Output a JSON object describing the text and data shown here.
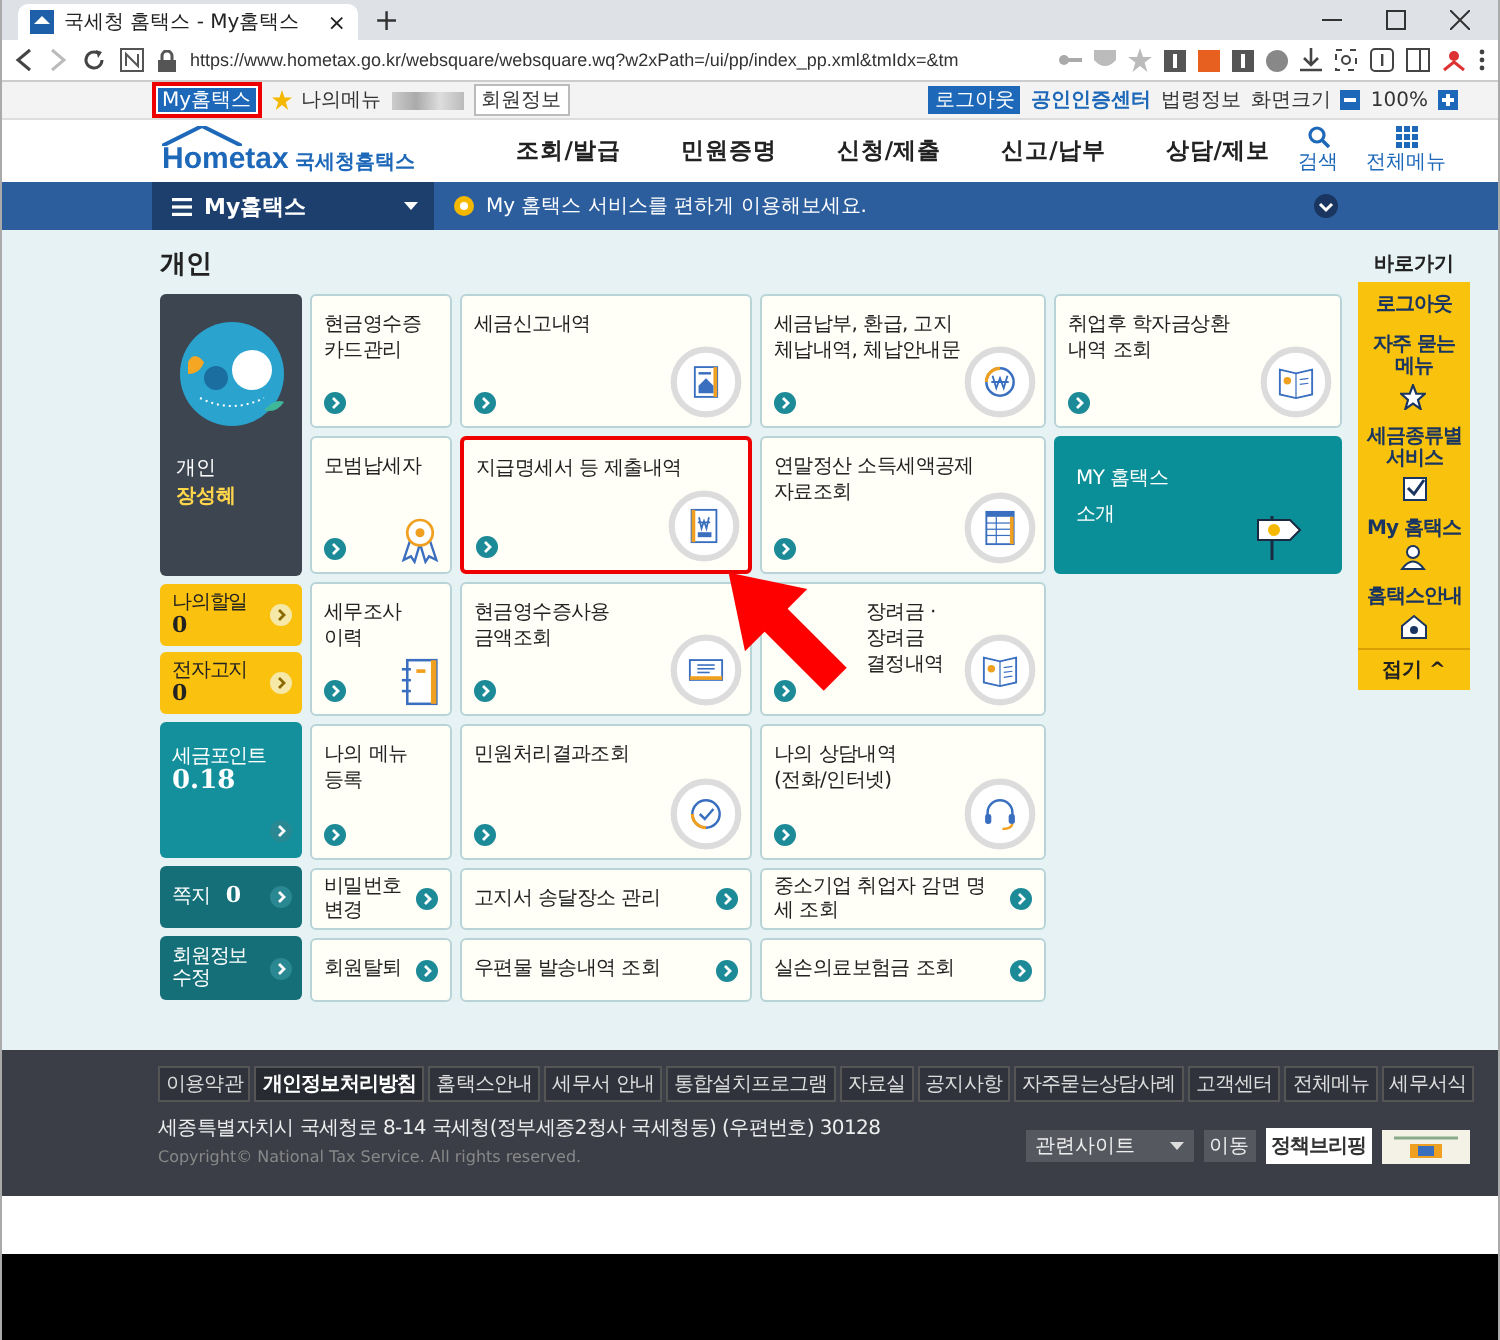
{
  "browser": {
    "tab_title": "국세청 홈택스 - My홈택스",
    "tab_close": "×",
    "new_tab": "+",
    "url": "https://www.hometax.go.kr/websquare/websquare.wq?w2xPath=/ui/pp/index_pp.xml&tmIdx=&tm"
  },
  "top_bar": {
    "my_button": {
      "label": "My홈택스",
      "highlighted": true
    },
    "my_menu": "나의메뉴",
    "member_info": "회원정보",
    "logout": "로그아웃",
    "cert_center": "공인인증센터",
    "law_info": "법령정보",
    "screen_size": "화면크기",
    "zoom": "100%"
  },
  "header": {
    "logo": "Hometax",
    "logo_sub": "국세청홈택스",
    "nav": [
      "조회/발급",
      "민원증명",
      "신청/제출",
      "신고/납부",
      "상담/제보"
    ],
    "search": "검색",
    "all_menu": "전체메뉴"
  },
  "my_bar": {
    "title": "My홈택스",
    "message": "My 홈택스 서비스를 편하게 이용해보세요."
  },
  "section_title": "개인",
  "profile": {
    "type": "개인",
    "name": "장성혜"
  },
  "status": [
    {
      "kind": "todo",
      "label": "나의할일",
      "value": "0"
    },
    {
      "kind": "todo",
      "label": "전자고지",
      "value": "0"
    },
    {
      "kind": "points",
      "label": "세금포인트",
      "value": "0.18"
    },
    {
      "kind": "inline",
      "label": "쪽지",
      "value": "0"
    },
    {
      "kind": "plain",
      "label": "회원정보\n수정"
    }
  ],
  "tiles": [
    {
      "kind": "narrow",
      "label": "현금영수증\n카드관리",
      "highlighted": false
    },
    {
      "kind": "large",
      "label": "세금신고내역",
      "highlighted": false
    },
    {
      "kind": "large",
      "label": "세금납부, 환급, 고지\n체납내역, 체납안내문",
      "highlighted": false
    },
    {
      "kind": "narrow",
      "label": "모범납세자",
      "highlighted": false
    },
    {
      "kind": "large",
      "label": "지급명세서 등 제출내역",
      "highlighted": true
    },
    {
      "kind": "large",
      "label": "연말정산 소득세액공제\n자료조회",
      "highlighted": false
    },
    {
      "kind": "narrow",
      "label": "세무조사\n이력",
      "highlighted": false
    },
    {
      "kind": "large",
      "label": "현금영수증사용\n금액조회",
      "highlighted": false
    },
    {
      "kind": "large",
      "label": "장려금 ·\n장려금\n결정내역",
      "highlighted": false
    },
    {
      "kind": "narrow",
      "label": "나의 메뉴\n등록",
      "highlighted": false
    },
    {
      "kind": "large",
      "label": "민원처리결과조회",
      "highlighted": false
    },
    {
      "kind": "large",
      "label": "나의 상담내역\n(전화/인터넷)",
      "highlighted": false
    },
    {
      "kind": "link",
      "label": "비밀번호\n변경",
      "highlighted": false
    },
    {
      "kind": "link",
      "label": "고지서 송달장소 관리",
      "highlighted": false
    },
    {
      "kind": "link",
      "label": "중소기업 취업자 감면 명세 조회",
      "highlighted": false
    },
    {
      "kind": "link",
      "label": "회원탈퇴",
      "highlighted": false
    },
    {
      "kind": "link",
      "label": "우편물 발송내역 조회",
      "highlighted": false
    },
    {
      "kind": "link",
      "label": "실손의료보험금 조회",
      "highlighted": false
    }
  ],
  "side_tiles": [
    {
      "kind": "large",
      "label": "취업후 학자금상환\n내역 조회"
    },
    {
      "kind": "feature",
      "label": "MY 홈택스\n소개"
    }
  ],
  "quick_menu": {
    "title": "바로가기",
    "items": [
      "로그아웃",
      "자주 묻는\n메뉴",
      "세금종류별\n서비스",
      "My 홈택스",
      "홈택스안내"
    ],
    "fold": "접기 ^"
  },
  "footer": {
    "links": [
      {
        "label": "이용약관",
        "selected": false
      },
      {
        "label": "개인정보처리방침",
        "selected": true
      },
      {
        "label": "홈택스안내",
        "selected": false
      },
      {
        "label": "세무서 안내",
        "selected": false
      },
      {
        "label": "통합설치프로그램",
        "selected": false
      },
      {
        "label": "자료실",
        "selected": false
      },
      {
        "label": "공지사항",
        "selected": false
      },
      {
        "label": "자주묻는상담사례",
        "selected": false
      },
      {
        "label": "고객센터",
        "selected": false
      },
      {
        "label": "전체메뉴",
        "selected": false
      },
      {
        "label": "세무서식",
        "selected": false
      }
    ],
    "address": "세종특별자치시 국세청로 8-14 국세청(정부세종2청사 국세청동) (우편번호) 30128",
    "copyright": "Copyright© National Tax Service. All rights reserved.",
    "related_select": "관련사이트",
    "go_button": "이동",
    "banner": "정책브리핑"
  }
}
